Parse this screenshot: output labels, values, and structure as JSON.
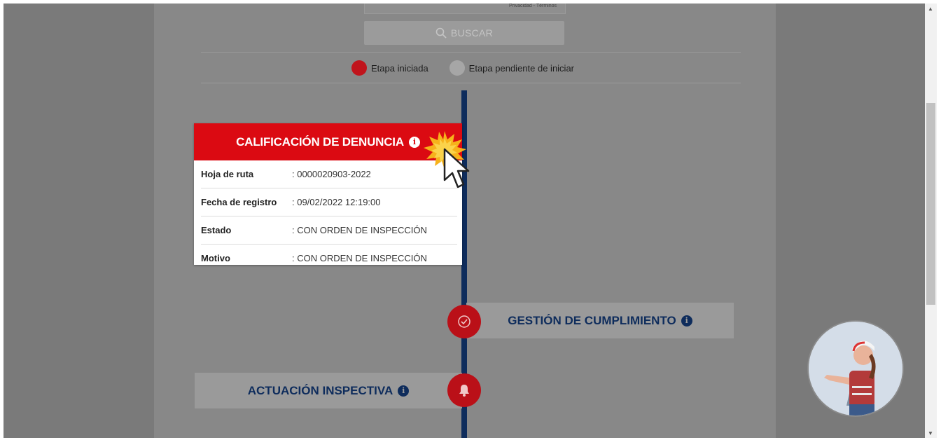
{
  "captcha": {
    "text": "Privacidad - Términos"
  },
  "search": {
    "label": "BUSCAR"
  },
  "legend": {
    "started": "Etapa iniciada",
    "pending": "Etapa pendiente de iniciar"
  },
  "card": {
    "title": "CALIFICACIÓN DE DENUNCIA",
    "rows": [
      {
        "label": "Hoja de ruta",
        "value": ": 0000020903-2022"
      },
      {
        "label": "Fecha de registro",
        "value": ": 09/02/2022 12:19:00"
      },
      {
        "label": "Estado",
        "value": ": CON ORDEN DE INSPECCIÓN"
      },
      {
        "label": "Motivo",
        "value": ": CON ORDEN DE INSPECCIÓN"
      }
    ]
  },
  "stages": {
    "gestion": "GESTIÓN DE CUMPLIMIENTO",
    "actuacion": "ACTUACIÓN INSPECTIVA"
  },
  "colors": {
    "accent_red": "#db0a12",
    "navy": "#0e2c5c",
    "overlay_gray": "#888888"
  },
  "icons": {
    "search": "search-icon",
    "info": "info-icon",
    "check": "check-circle-icon",
    "bell": "bell-icon",
    "cursor": "hand-pointer-icon",
    "assistant": "assistant-avatar"
  }
}
